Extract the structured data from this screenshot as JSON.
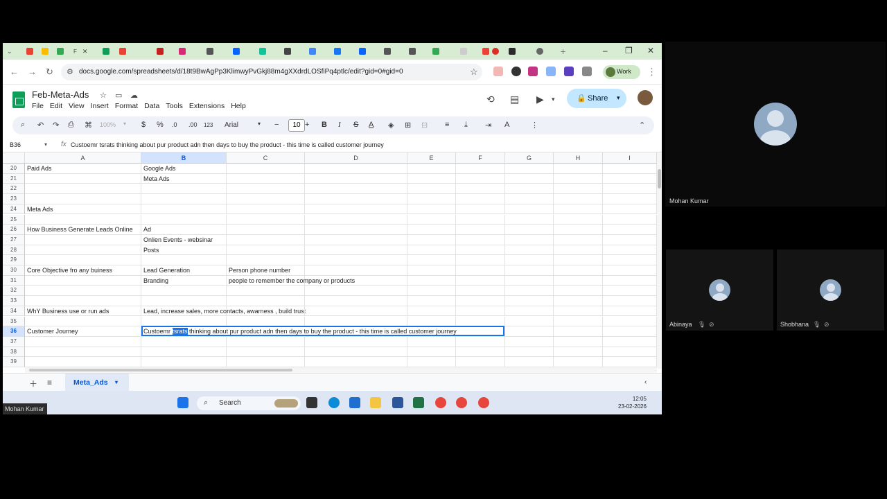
{
  "browser": {
    "tabs_visible_icons": [
      "gmail-icon",
      "drive-icon",
      "sheets-icon",
      "sheets-icon",
      "gmail-icon",
      "gmail-icon",
      "instagram-icon",
      "chatgpt-icon",
      "meta-icon",
      "grammarly-icon",
      "chatgpt-icon",
      "chatgpt-icon",
      "facebook-icon",
      "meta-icon",
      "chatgpt-icon",
      "chatgpt-icon",
      "link-icon",
      "doc-icon",
      "gmail-icon",
      "record-icon",
      "info-icon"
    ],
    "active_tab_label": "F",
    "url": "docs.google.com/spreadsheets/d/18t9BwAgPp3KlimwyPvGkj88m4gXXdrdLOSfiPq4ptlc/edit?gid=0#gid=0",
    "profile_label": "Work"
  },
  "sheets": {
    "title": "Feb-Meta-Ads",
    "menu": [
      "File",
      "Edit",
      "View",
      "Insert",
      "Format",
      "Data",
      "Tools",
      "Extensions",
      "Help"
    ],
    "share_label": "Share",
    "toolbar": {
      "zoom": "100%",
      "currency": "$",
      "percent": "%",
      "dec_decrease": ".0",
      "dec_increase": ".00",
      "number_format": "123",
      "font": "Arial",
      "font_size": "10"
    },
    "name_box": "B36",
    "formula": "Custoemr tsrats thinking about pur product adn then days to buy the product - this time is called customer journey",
    "columns": [
      "A",
      "B",
      "C",
      "D",
      "E",
      "F",
      "G",
      "H",
      "I"
    ],
    "selected_column": "B",
    "rows": [
      {
        "n": "20",
        "A": "Paid Ads",
        "B": "Google Ads",
        "C": ""
      },
      {
        "n": "21",
        "A": "",
        "B": "Meta Ads",
        "C": ""
      },
      {
        "n": "22",
        "A": "",
        "B": "",
        "C": ""
      },
      {
        "n": "23",
        "A": "",
        "B": "",
        "C": ""
      },
      {
        "n": "24",
        "A": "Meta Ads",
        "B": "",
        "C": ""
      },
      {
        "n": "25",
        "A": "",
        "B": "",
        "C": ""
      },
      {
        "n": "26",
        "A": "How Business Generate Leads Online",
        "B": "Ad",
        "C": ""
      },
      {
        "n": "27",
        "A": "",
        "B": "Onlien Events - websinar",
        "C": ""
      },
      {
        "n": "28",
        "A": "",
        "B": "Posts",
        "C": ""
      },
      {
        "n": "29",
        "A": "",
        "B": "",
        "C": ""
      },
      {
        "n": "30",
        "A": "Core Objective fro any buiness",
        "B": "Lead Generation",
        "C": "Person phone number"
      },
      {
        "n": "31",
        "A": "",
        "B": "Branding",
        "C": "people to remember the company or products"
      },
      {
        "n": "32",
        "A": "",
        "B": "",
        "C": ""
      },
      {
        "n": "33",
        "A": "",
        "B": "",
        "C": ""
      },
      {
        "n": "34",
        "A": "WhY Business use or run ads",
        "B": "Lead, increase sales, more contacts, awarness , build trust",
        "C": ""
      },
      {
        "n": "35",
        "A": "",
        "B": "",
        "C": ""
      },
      {
        "n": "36",
        "A": "Customer Journey",
        "B": "",
        "C": ""
      },
      {
        "n": "37",
        "A": "",
        "B": "",
        "C": ""
      },
      {
        "n": "38",
        "A": "",
        "B": "",
        "C": ""
      },
      {
        "n": "39",
        "A": "",
        "B": "",
        "C": ""
      }
    ],
    "selected_row": "36",
    "editor": {
      "before": "Custoemr ",
      "highlight": "tsrats",
      "after": " thinking about pur product adn then days to buy the product - this time is called customer journey"
    },
    "sheet_tab": "Meta_Ads"
  },
  "taskbar": {
    "search_placeholder": "Search",
    "time": "12:05",
    "date": "23-02-2026"
  },
  "meeting": {
    "presenter_label": "Mohan Kumar",
    "participants": [
      {
        "name": "Mohan Kumar"
      },
      {
        "name": "Abinaya"
      },
      {
        "name": "Shobhana"
      }
    ]
  }
}
